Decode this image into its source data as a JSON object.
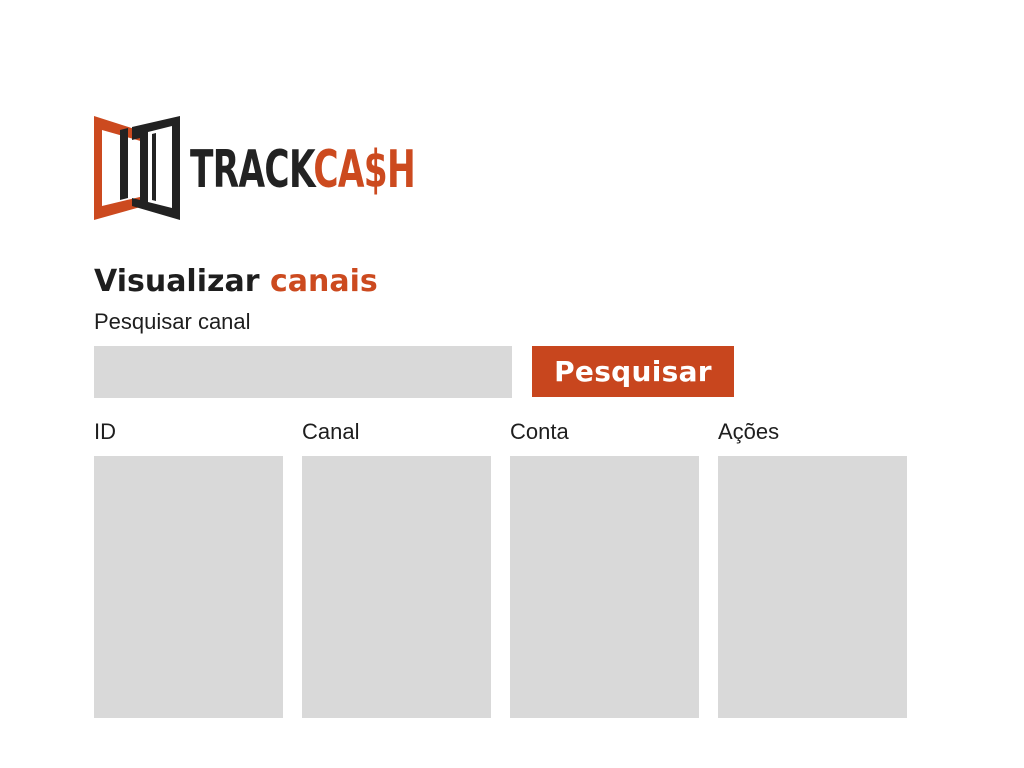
{
  "logo": {
    "word_part1": "TRACK",
    "word_part2_c": "C",
    "word_part2_rest": "A$H",
    "alt": "TrackCash logo",
    "colors": {
      "dark": "#222222",
      "accent": "#cc4a1f"
    }
  },
  "page": {
    "title_part1": "Visualizar",
    "title_part2": "canais"
  },
  "search": {
    "label": "Pesquisar canal",
    "value": "",
    "placeholder": "",
    "button_label": "Pesquisar"
  },
  "table": {
    "columns": [
      {
        "header": "ID"
      },
      {
        "header": "Canal"
      },
      {
        "header": "Conta"
      },
      {
        "header": "Ações"
      }
    ],
    "rows": []
  },
  "colors": {
    "accent": "#c8461e",
    "field_bg": "#d9d9d9",
    "text": "#1e1e1e"
  }
}
